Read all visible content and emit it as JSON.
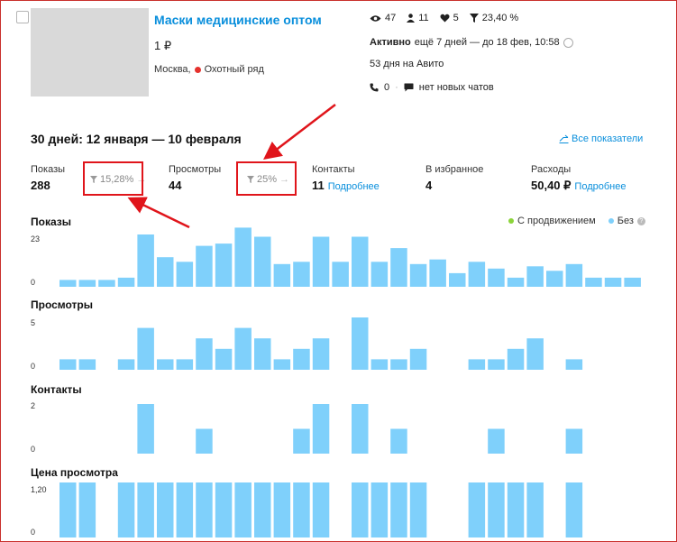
{
  "listing": {
    "title": "Маски медицинские оптом",
    "price": "1 ₽",
    "city": "Москва,",
    "metro": "Охотный ряд"
  },
  "top_stats": {
    "views": "47",
    "contacts": "11",
    "favorites": "5",
    "conversion": "23,40 %"
  },
  "status": {
    "active_label": "Активно",
    "active_rest": "ещё 7 дней — до 18 фев, 10:58",
    "days_on": "53 дня на Авито",
    "calls": "0",
    "sep": "·",
    "chats": "нет новых чатов"
  },
  "period": "30 дней: 12 января — 10 февраля",
  "all_metrics": "Все показатели",
  "metrics": {
    "shows_label": "Показы",
    "shows_value": "288",
    "conv1": "15,28%",
    "views_label": "Просмотры",
    "views_value": "44",
    "conv2": "25%",
    "contacts_label": "Контакты",
    "contacts_value": "11",
    "contacts_link": "Подробнее",
    "fav_label": "В избранное",
    "fav_value": "4",
    "cost_label": "Расходы",
    "cost_value": "50,40 ₽",
    "cost_link": "Подробнее"
  },
  "legend": {
    "promo": "С продвижением",
    "base": "Без"
  },
  "colors": {
    "bar": "#7fd0fb",
    "promo": "#8bd43a",
    "accent": "#0a8fdc",
    "highlight": "#e0151b"
  },
  "chart_data": [
    {
      "type": "bar",
      "title": "Показы",
      "ylim": [
        0,
        23
      ],
      "ticks": [
        "23",
        "0"
      ],
      "x": [
        1,
        2,
        3,
        4,
        5,
        6,
        7,
        8,
        9,
        10,
        11,
        12,
        13,
        14,
        15,
        16,
        17,
        18,
        19,
        20,
        21,
        22,
        23,
        24,
        25,
        26,
        27,
        28,
        29,
        30
      ],
      "values": [
        3,
        3,
        3,
        4,
        23,
        13,
        11,
        18,
        19,
        26,
        22,
        10,
        11,
        22,
        11,
        22,
        11,
        17,
        10,
        12,
        6,
        11,
        8,
        4,
        9,
        7,
        10,
        4,
        4,
        4
      ]
    },
    {
      "type": "bar",
      "title": "Просмотры",
      "ylim": [
        0,
        5
      ],
      "ticks": [
        "5",
        "0"
      ],
      "x": [
        1,
        2,
        3,
        4,
        5,
        6,
        7,
        8,
        9,
        10,
        11,
        12,
        13,
        14,
        15,
        16,
        17,
        18,
        19,
        20,
        21,
        22,
        23,
        24,
        25,
        26,
        27,
        28,
        29,
        30
      ],
      "values": [
        1,
        1,
        0,
        1,
        4,
        1,
        1,
        3,
        2,
        4,
        3,
        1,
        2,
        3,
        0,
        5,
        1,
        1,
        2,
        0,
        0,
        1,
        1,
        2,
        3,
        0,
        1,
        0,
        0,
        0
      ]
    },
    {
      "type": "bar",
      "title": "Контакты",
      "ylim": [
        0,
        2
      ],
      "ticks": [
        "2",
        "0"
      ],
      "x": [
        1,
        2,
        3,
        4,
        5,
        6,
        7,
        8,
        9,
        10,
        11,
        12,
        13,
        14,
        15,
        16,
        17,
        18,
        19,
        20,
        21,
        22,
        23,
        24,
        25,
        26,
        27,
        28,
        29,
        30
      ],
      "values": [
        0,
        0,
        0,
        0,
        2,
        0,
        0,
        1,
        0,
        0,
        0,
        0,
        1,
        2,
        0,
        2,
        0,
        1,
        0,
        0,
        0,
        0,
        1,
        0,
        0,
        0,
        1,
        0,
        0,
        0
      ]
    },
    {
      "type": "bar",
      "title": "Цена просмотра",
      "ylim": [
        0,
        1.2
      ],
      "ticks": [
        "1,20",
        "0"
      ],
      "x": [
        1,
        2,
        3,
        4,
        5,
        6,
        7,
        8,
        9,
        10,
        11,
        12,
        13,
        14,
        15,
        16,
        17,
        18,
        19,
        20,
        21,
        22,
        23,
        24,
        25,
        26,
        27,
        28,
        29,
        30
      ],
      "values": [
        1.2,
        1.2,
        0,
        1.2,
        1.2,
        1.2,
        1.2,
        1.2,
        1.2,
        1.2,
        1.2,
        1.2,
        1.2,
        1.2,
        0,
        1.2,
        1.2,
        1.2,
        1.2,
        0,
        0,
        1.2,
        1.2,
        1.2,
        1.2,
        0,
        1.2,
        0,
        0,
        0
      ]
    }
  ]
}
